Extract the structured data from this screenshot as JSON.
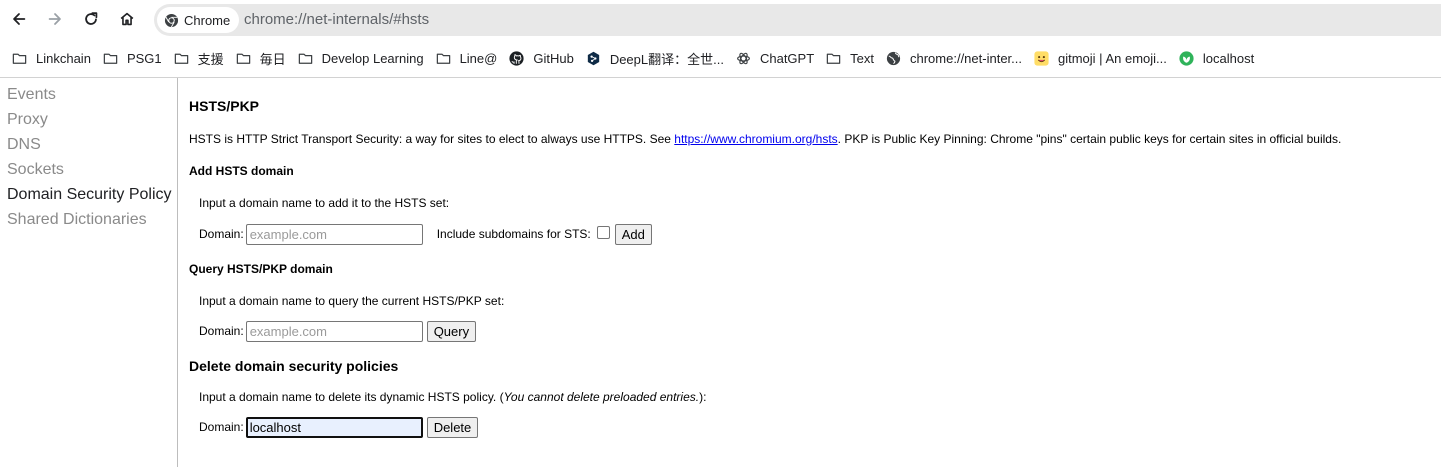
{
  "toolbar": {
    "chip_label": "Chrome",
    "url": "chrome://net-internals/#hsts"
  },
  "bookmarks": [
    {
      "label": "Linkchain",
      "icon": "folder-icon"
    },
    {
      "label": "PSG1",
      "icon": "folder-icon"
    },
    {
      "label": "支援",
      "icon": "folder-icon"
    },
    {
      "label": "毎日",
      "icon": "folder-icon"
    },
    {
      "label": "Develop Learning",
      "icon": "folder-icon"
    },
    {
      "label": "Line@",
      "icon": "folder-icon"
    },
    {
      "label": "GitHub",
      "icon": "github-icon"
    },
    {
      "label": "DeepL翻译：全世...",
      "icon": "deepl-icon"
    },
    {
      "label": "ChatGPT",
      "icon": "chatgpt-icon"
    },
    {
      "label": "Text",
      "icon": "folder-icon"
    },
    {
      "label": "chrome://net-inter...",
      "icon": "globe-icon"
    },
    {
      "label": "gitmoji | An emoji...",
      "icon": "gitmoji-icon"
    },
    {
      "label": "localhost",
      "icon": "localhost-icon"
    }
  ],
  "sidebar": {
    "items": [
      {
        "label": "Events",
        "selected": false
      },
      {
        "label": "Proxy",
        "selected": false
      },
      {
        "label": "DNS",
        "selected": false
      },
      {
        "label": "Sockets",
        "selected": false
      },
      {
        "label": "Domain Security Policy",
        "selected": true
      },
      {
        "label": "Shared Dictionaries",
        "selected": false
      }
    ]
  },
  "main": {
    "title": "HSTS/PKP",
    "description": {
      "before": "HSTS is HTTP Strict Transport Security: a way for sites to elect to always use HTTPS. See ",
      "link": "https://www.chromium.org/hsts",
      "after": ". PKP is Public Key Pinning: Chrome \"pins\" certain public keys for certain sites in official builds."
    },
    "add": {
      "heading": "Add HSTS domain",
      "instruction": "Input a domain name to add it to the HSTS set:",
      "domain_label": "Domain:",
      "placeholder": "example.com",
      "value": "",
      "subdomains_label": "Include subdomains for STS:",
      "subdomains_checked": false,
      "button": "Add"
    },
    "query": {
      "heading": "Query HSTS/PKP domain",
      "instruction": "Input a domain name to query the current HSTS/PKP set:",
      "domain_label": "Domain:",
      "placeholder": "example.com",
      "value": "",
      "button": "Query"
    },
    "delete": {
      "heading": "Delete domain security policies",
      "instruction_before": "Input a domain name to delete its dynamic HSTS policy. (",
      "instruction_italic": "You cannot delete preloaded entries.",
      "instruction_after": "):",
      "domain_label": "Domain:",
      "value": "localhost",
      "button": "Delete"
    }
  },
  "colors": {
    "link": "#0000ee",
    "sidebar_inactive": "#8a8a8a",
    "sidebar_active": "#202124",
    "omnibox_bg": "#e8e8e8",
    "focused_input_bg": "#e8f0fe"
  }
}
